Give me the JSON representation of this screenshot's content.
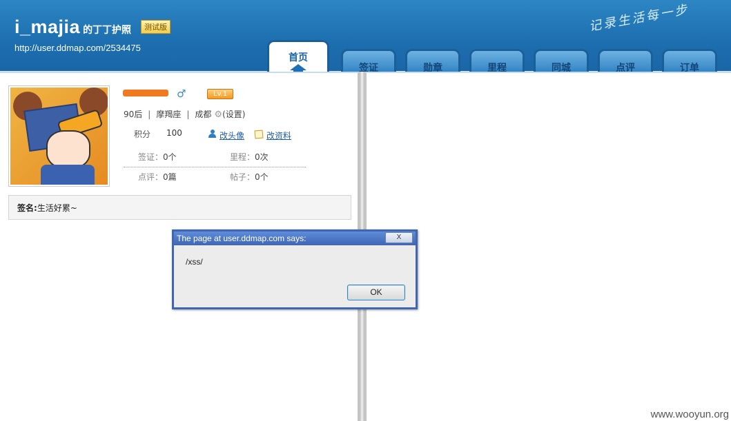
{
  "header": {
    "username": "i_majia",
    "passport_suffix": "的丁丁护照",
    "beta_badge": "测试版",
    "url": "http://user.ddmap.com/2534475",
    "slogan": "记录生活每一步"
  },
  "tabs": [
    {
      "label": "首页",
      "active": true,
      "icon": "home-icon"
    },
    {
      "label": "签证"
    },
    {
      "label": "勋章"
    },
    {
      "label": "里程"
    },
    {
      "label": "同城"
    },
    {
      "label": "点评"
    },
    {
      "label": "订单"
    }
  ],
  "profile": {
    "gender_icon": "male-icon",
    "level": "Lv.1",
    "age_group": "90后",
    "zodiac": "摩羯座",
    "city": "成都",
    "settings_label": "(设置)",
    "points_label": "积分",
    "points_value": "100",
    "edit_avatar_label": "改头像",
    "edit_profile_label": "改资料",
    "stats": {
      "visa": {
        "label": "签证：",
        "value": "0个"
      },
      "mileage": {
        "label": "里程：",
        "value": "0次"
      },
      "reviews": {
        "label": "点评：",
        "value": "0篇"
      },
      "posts": {
        "label": "帖子：",
        "value": "0个"
      }
    },
    "signature_label": "签名:",
    "signature_text": "生活好累~"
  },
  "dialog": {
    "title": "The page at user.ddmap.com says:",
    "close_label": "X",
    "message": "/xss/",
    "ok_label": "OK"
  },
  "watermark": "www.wooyun.org",
  "colors": {
    "header_blue": "#1d6fb0",
    "tab_border": "#1a5f97",
    "link_blue": "#1f5ea8",
    "level_orange": "#f49a20",
    "dialog_blue": "#3f66b2"
  }
}
